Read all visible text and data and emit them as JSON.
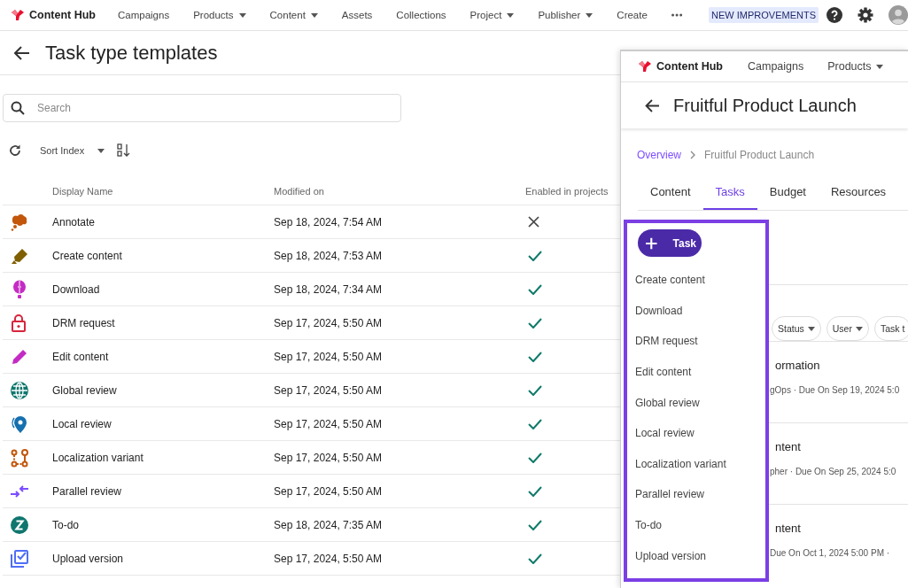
{
  "top_nav": {
    "brand": "Content Hub",
    "items": [
      {
        "label": "Campaigns",
        "menu": false
      },
      {
        "label": "Products",
        "menu": true
      },
      {
        "label": "Content",
        "menu": true
      },
      {
        "label": "Assets",
        "menu": false
      },
      {
        "label": "Collections",
        "menu": false
      },
      {
        "label": "Project",
        "menu": true
      },
      {
        "label": "Publisher",
        "menu": true
      },
      {
        "label": "Create",
        "menu": false
      }
    ],
    "badge": "NEW IMPROVEMENTS"
  },
  "page": {
    "title": "Task type templates",
    "search": {
      "placeholder": "Search"
    },
    "sort": {
      "label": "Sort Index"
    },
    "table": {
      "columns": [
        "Display Name",
        "Modified on",
        "Enabled in projects"
      ],
      "rows": [
        {
          "name": "Annotate",
          "modified": "Sep 18, 2024, 7:54 AM",
          "enabled": false
        },
        {
          "name": "Create content",
          "modified": "Sep 18, 2024, 7:53 AM",
          "enabled": true
        },
        {
          "name": "Download",
          "modified": "Sep 18, 2024, 7:34 AM",
          "enabled": true
        },
        {
          "name": "DRM request",
          "modified": "Sep 17, 2024, 5:50 AM",
          "enabled": true
        },
        {
          "name": "Edit content",
          "modified": "Sep 17, 2024, 5:50 AM",
          "enabled": true
        },
        {
          "name": "Global review",
          "modified": "Sep 17, 2024, 5:50 AM",
          "enabled": true
        },
        {
          "name": "Local review",
          "modified": "Sep 17, 2024, 5:50 AM",
          "enabled": true
        },
        {
          "name": "Localization variant",
          "modified": "Sep 17, 2024, 5:50 AM",
          "enabled": true
        },
        {
          "name": "Parallel review",
          "modified": "Sep 17, 2024, 5:50 AM",
          "enabled": true
        },
        {
          "name": "To-do",
          "modified": "Sep 18, 2024, 7:35 AM",
          "enabled": true
        },
        {
          "name": "Upload version",
          "modified": "Sep 17, 2024, 5:50 AM",
          "enabled": true
        }
      ]
    }
  },
  "project_window": {
    "nav": {
      "brand": "Content Hub",
      "items": [
        {
          "label": "Campaigns",
          "menu": false
        },
        {
          "label": "Products",
          "menu": true
        }
      ]
    },
    "title": "Fruitful Product Launch",
    "breadcrumb": [
      "Overview",
      "Fruitful Product Launch"
    ],
    "tabs": [
      {
        "label": "Content",
        "selected": false
      },
      {
        "label": "Tasks",
        "selected": true
      },
      {
        "label": "Budget",
        "selected": false
      },
      {
        "label": "Resources",
        "selected": false
      }
    ],
    "filters": [
      {
        "label": "Status",
        "menu": true
      },
      {
        "label": "User",
        "menu": true
      },
      {
        "label": "Task t",
        "menu": false
      }
    ],
    "tasks": [
      {
        "title": "ormation",
        "meta": "gOps ·  Due On Sep 19, 2024 5:0"
      },
      {
        "title": "ntent",
        "meta": "pher ·  Due On Sep 25, 2024 5:0"
      },
      {
        "title": "ntent",
        "meta": "Due On Oct 1, 2024 5:00 PM ·"
      }
    ],
    "add_menu": {
      "button": "Task",
      "items": [
        "Create content",
        "Download",
        "DRM request",
        "Edit content",
        "Global review",
        "Local review",
        "Localization variant",
        "Parallel review",
        "To-do",
        "Upload version"
      ]
    }
  }
}
